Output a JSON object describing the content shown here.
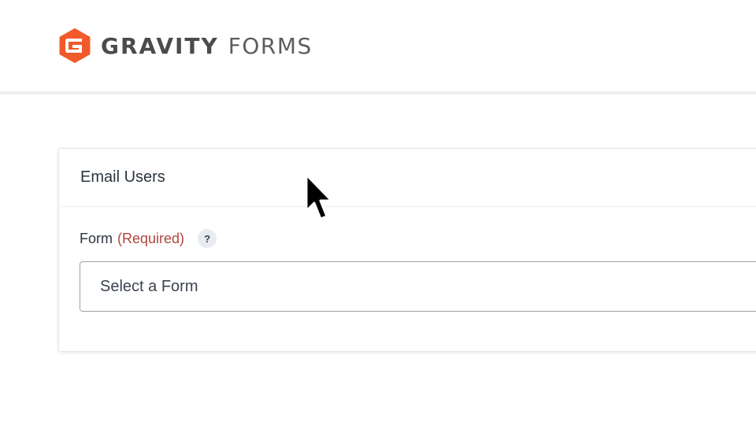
{
  "brand": {
    "name_strong": "GRAVITY",
    "name_light": "FORMS",
    "accent": "#f15a2b",
    "icon": "gravity-forms-logo-icon"
  },
  "card": {
    "title": "Email Users"
  },
  "form_field": {
    "label": "Form",
    "required": "(Required)",
    "help_glyph": "?",
    "help_icon": "help-icon",
    "select_value": "Select a Form"
  },
  "pointer": {
    "icon": "mouse-pointer-icon"
  }
}
